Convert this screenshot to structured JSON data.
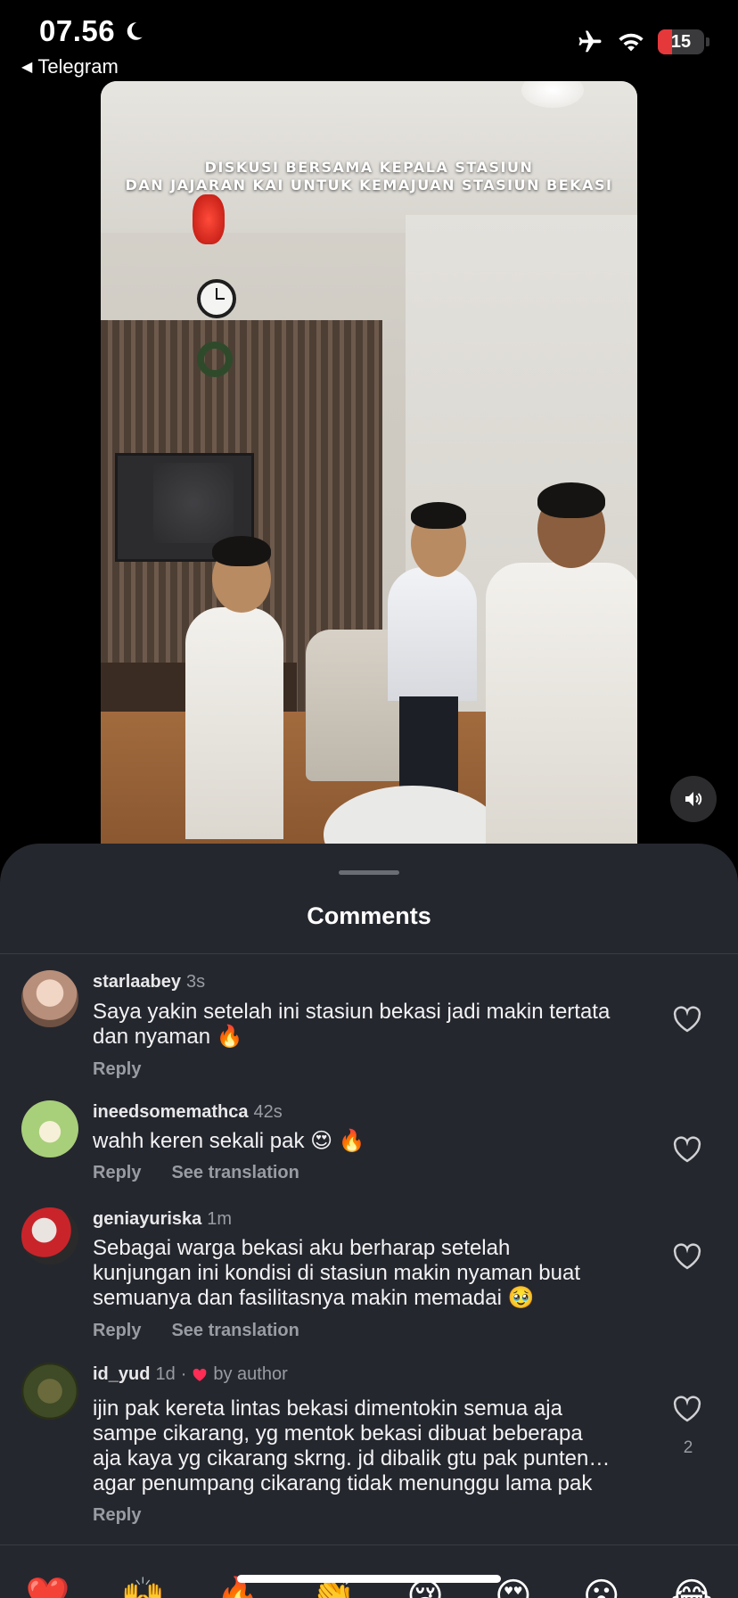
{
  "status_bar": {
    "time": "07.56",
    "back_app": "Telegram",
    "battery": "15"
  },
  "video": {
    "title_line1": "DISKUSI BERSAMA KEPALA STASIUN",
    "title_line2": "DAN JAJARAN KAI UNTUK KEMAJUAN STASIUN BEKASI"
  },
  "sheet": {
    "title": "Comments"
  },
  "comments": [
    {
      "user": "starlaabey",
      "time": "3s",
      "lines": [
        "Saya yakin setelah ini stasiun bekasi jadi makin tertata",
        "dan nyaman 🔥"
      ],
      "reply": "Reply"
    },
    {
      "user": "ineedsomemathca",
      "time": "42s",
      "lines": [
        "wahh keren sekali pak 😍 🔥"
      ],
      "reply": "Reply",
      "translate": "See translation"
    },
    {
      "user": "geniayuriska",
      "time": "1m",
      "lines": [
        "Sebagai warga bekasi aku berharap setelah",
        "kunjungan ini kondisi di stasiun makin nyaman buat",
        "semuanya dan fasilitasnya makin memadai 🥹"
      ],
      "reply": "Reply",
      "translate": "See translation"
    },
    {
      "user": "id_yud",
      "time": "1d",
      "separator": "·",
      "by_author": "by author",
      "lines": [
        "ijin pak kereta lintas bekasi dimentokin semua aja",
        "sampe cikarang, yg mentok bekasi dibuat beberapa",
        "aja kaya yg cikarang skrng. jd dibalik gtu pak punten…",
        "agar penumpang cikarang tidak menunggu lama pak"
      ],
      "reply": "Reply",
      "likes": "2"
    }
  ],
  "emoji_bar": [
    "❤️",
    "🙌",
    "🔥",
    "👏",
    "😢",
    "😍",
    "😮",
    "😂"
  ],
  "colors": {
    "sheet_bg": "#25272e",
    "battery_red": "#e5383b",
    "heart_red": "#ff2d55",
    "muted_text": "#9a9ca3"
  },
  "icons": [
    "moon-icon",
    "airplane-icon",
    "wifi-icon",
    "volume-icon",
    "heart-outline-icon",
    "heart-filled-icon"
  ]
}
